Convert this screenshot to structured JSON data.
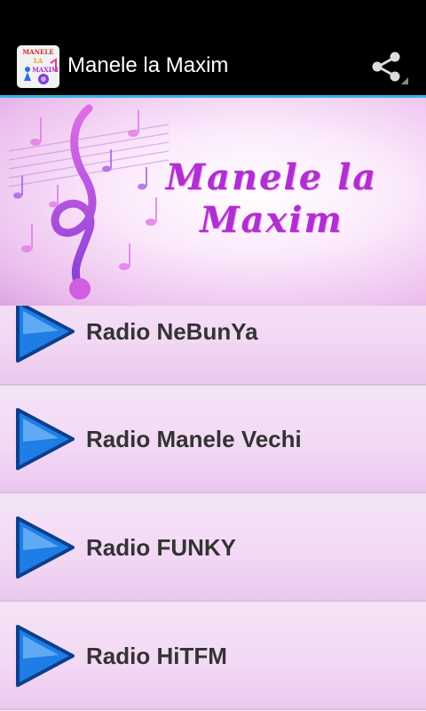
{
  "app": {
    "title": "Manele la Maxim",
    "icon_text_line1": "MANELE",
    "icon_text_line2": "LA",
    "icon_text_line3": "MAXIM"
  },
  "actions": {
    "share_icon": "share-icon"
  },
  "banner": {
    "title_line1": "Manele la",
    "title_line2": "Maxim",
    "accent_color": "#b12ed1"
  },
  "stations": [
    {
      "label": "Radio NeBunYa",
      "icon": "play-icon"
    },
    {
      "label": "Radio Manele Vechi",
      "icon": "play-icon"
    },
    {
      "label": "Radio FUNKY",
      "icon": "play-icon"
    },
    {
      "label": "Radio HiTFM",
      "icon": "play-icon"
    }
  ],
  "colors": {
    "action_bar_divider": "#33b5e5",
    "play_blue": "#1f7de6"
  }
}
